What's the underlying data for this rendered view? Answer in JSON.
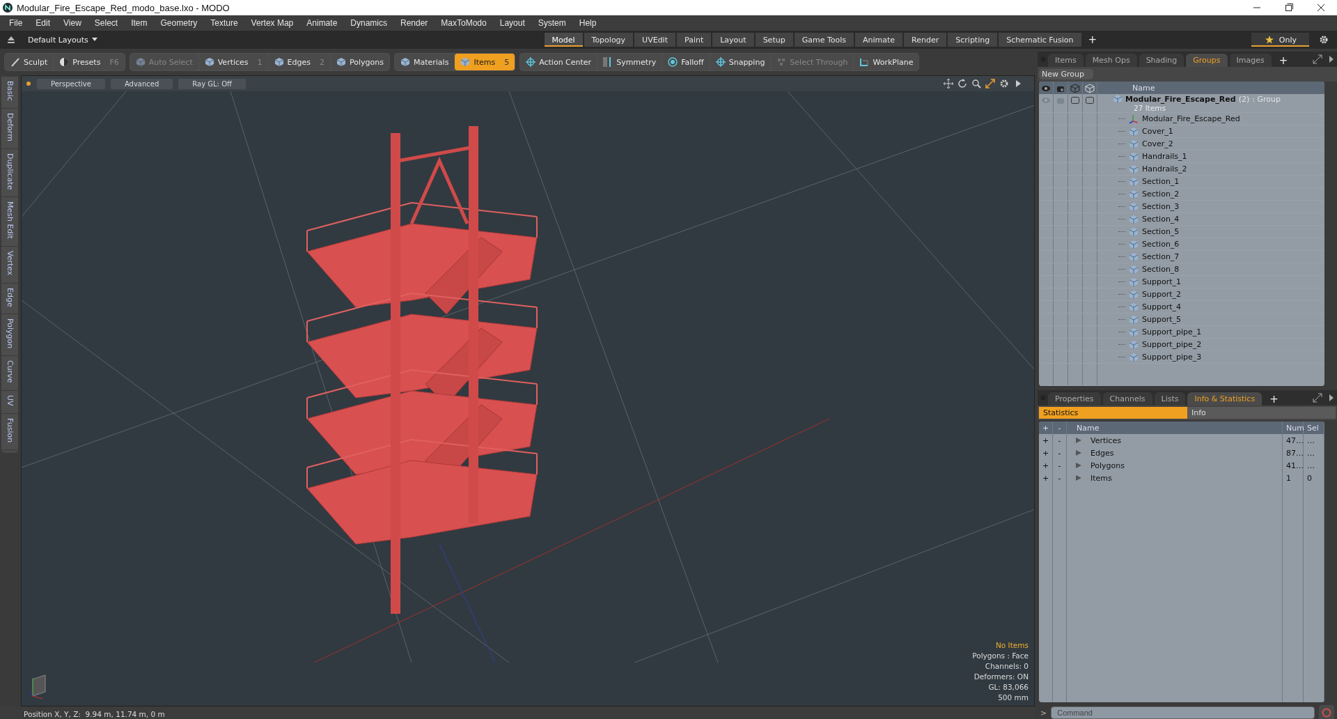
{
  "window": {
    "title": "Modular_Fire_Escape_Red_modo_base.lxo - MODO"
  },
  "menu": [
    "File",
    "Edit",
    "View",
    "Select",
    "Item",
    "Geometry",
    "Texture",
    "Vertex Map",
    "Animate",
    "Dynamics",
    "Render",
    "MaxToModo",
    "Layout",
    "System",
    "Help"
  ],
  "layout_bar": {
    "layout_menu": "Default Layouts",
    "tabs": [
      {
        "label": "Model",
        "selected": true
      },
      {
        "label": "Topology",
        "selected": false
      },
      {
        "label": "UVEdit",
        "selected": false
      },
      {
        "label": "Paint",
        "selected": false
      },
      {
        "label": "Layout",
        "selected": false
      },
      {
        "label": "Setup",
        "selected": false
      },
      {
        "label": "Game Tools",
        "selected": false
      },
      {
        "label": "Animate",
        "selected": false
      },
      {
        "label": "Render",
        "selected": false
      },
      {
        "label": "Scripting",
        "selected": false
      },
      {
        "label": "Schematic Fusion",
        "selected": false
      }
    ],
    "add_tab": "+",
    "only_button": "Only"
  },
  "toolbar": [
    [
      {
        "label": "Sculpt",
        "kind": "sculpt",
        "selected": false,
        "disabled": false
      },
      {
        "label": "Presets",
        "kind": "presets",
        "shortcut": "F6",
        "selected": false,
        "disabled": false
      }
    ],
    [
      {
        "label": "Auto Select",
        "kind": "cube",
        "selected": false,
        "disabled": true
      },
      {
        "label": "Vertices",
        "kind": "cube",
        "shortcut": "1",
        "selected": false,
        "disabled": false
      },
      {
        "label": "Edges",
        "kind": "cube",
        "shortcut": "2",
        "selected": false,
        "disabled": false
      },
      {
        "label": "Polygons",
        "kind": "cube",
        "selected": false,
        "disabled": false
      }
    ],
    [
      {
        "label": "Materials",
        "kind": "cube",
        "selected": false,
        "disabled": false
      },
      {
        "label": "Items",
        "kind": "cube",
        "shortcut": "5",
        "selected": true,
        "disabled": false
      }
    ],
    [
      {
        "label": "Action Center",
        "kind": "crosshair",
        "selected": false,
        "disabled": false
      },
      {
        "label": "Symmetry",
        "kind": "symmetry",
        "selected": false,
        "disabled": false
      },
      {
        "label": "Falloff",
        "kind": "falloff",
        "selected": false,
        "disabled": false
      },
      {
        "label": "Snapping",
        "kind": "crosshair",
        "selected": false,
        "disabled": false
      },
      {
        "label": "Select Through",
        "kind": "through",
        "selected": false,
        "disabled": true
      },
      {
        "label": "WorkPlane",
        "kind": "workplane",
        "selected": false,
        "disabled": false
      }
    ]
  ],
  "side_tabs": [
    "Basic",
    "Deform",
    "Duplicate",
    "Mesh Edit",
    "Vertex",
    "Edge",
    "Polygon",
    "Curve",
    "UV",
    "Fusion"
  ],
  "viewport": {
    "buttons": [
      "Perspective",
      "Advanced",
      "Ray GL: Off"
    ],
    "info": [
      {
        "text": "No Items",
        "kind": "highlight"
      },
      {
        "text": "Polygons : Face",
        "kind": "normal"
      },
      {
        "text": "Channels: 0",
        "kind": "normal"
      },
      {
        "text": "Deformers: ON",
        "kind": "normal"
      },
      {
        "text": "GL: 83,066",
        "kind": "normal"
      },
      {
        "text": "500 mm",
        "kind": "normal"
      }
    ]
  },
  "groups_panel": {
    "tabs": [
      {
        "label": "Items",
        "selected": false
      },
      {
        "label": "Mesh Ops",
        "selected": false
      },
      {
        "label": "Shading",
        "selected": false
      },
      {
        "label": "Groups",
        "selected": true
      },
      {
        "label": "Images",
        "selected": false
      }
    ],
    "add_tab": "+",
    "new_group": "New Group",
    "name_column": "Name",
    "group": {
      "name": "Modular_Fire_Escape_Red",
      "count": "(2)",
      "type": ": Group",
      "subtitle": "27 Items",
      "children": [
        {
          "name": "Modular_Fire_Escape_Red",
          "kind": "locator"
        },
        {
          "name": "Cover_1",
          "kind": "mesh"
        },
        {
          "name": "Cover_2",
          "kind": "mesh"
        },
        {
          "name": "Handrails_1",
          "kind": "mesh"
        },
        {
          "name": "Handrails_2",
          "kind": "mesh"
        },
        {
          "name": "Section_1",
          "kind": "mesh"
        },
        {
          "name": "Section_2",
          "kind": "mesh"
        },
        {
          "name": "Section_3",
          "kind": "mesh"
        },
        {
          "name": "Section_4",
          "kind": "mesh"
        },
        {
          "name": "Section_5",
          "kind": "mesh"
        },
        {
          "name": "Section_6",
          "kind": "mesh"
        },
        {
          "name": "Section_7",
          "kind": "mesh"
        },
        {
          "name": "Section_8",
          "kind": "mesh"
        },
        {
          "name": "Support_1",
          "kind": "mesh"
        },
        {
          "name": "Support_2",
          "kind": "mesh"
        },
        {
          "name": "Support_4",
          "kind": "mesh"
        },
        {
          "name": "Support_5",
          "kind": "mesh"
        },
        {
          "name": "Support_pipe_1",
          "kind": "mesh"
        },
        {
          "name": "Support_pipe_2",
          "kind": "mesh"
        },
        {
          "name": "Support_pipe_3",
          "kind": "mesh"
        }
      ]
    }
  },
  "stats_panel": {
    "tabs": [
      {
        "label": "Properties",
        "selected": false
      },
      {
        "label": "Channels",
        "selected": false
      },
      {
        "label": "Lists",
        "selected": false
      },
      {
        "label": "Info & Statistics",
        "selected": true
      }
    ],
    "add_tab": "+",
    "subtabs": [
      {
        "label": "Statistics",
        "selected": true
      },
      {
        "label": "Info",
        "selected": false
      }
    ],
    "columns": [
      "+",
      "-",
      "Name",
      "Num",
      "Sel"
    ],
    "rows": [
      {
        "add": "+",
        "remove": "-",
        "name": "Vertices",
        "num": "47…",
        "sel": "…"
      },
      {
        "add": "+",
        "remove": "-",
        "name": "Edges",
        "num": "87…",
        "sel": "…"
      },
      {
        "add": "+",
        "remove": "-",
        "name": "Polygons",
        "num": "41…",
        "sel": "…"
      },
      {
        "add": "+",
        "remove": "-",
        "name": "Items",
        "num": "1",
        "sel": "0"
      }
    ]
  },
  "command": {
    "prompt": ">",
    "placeholder": "Command"
  },
  "status_bar": "Position X, Y, Z:  9.94 m, 11.74 m, 0 m"
}
